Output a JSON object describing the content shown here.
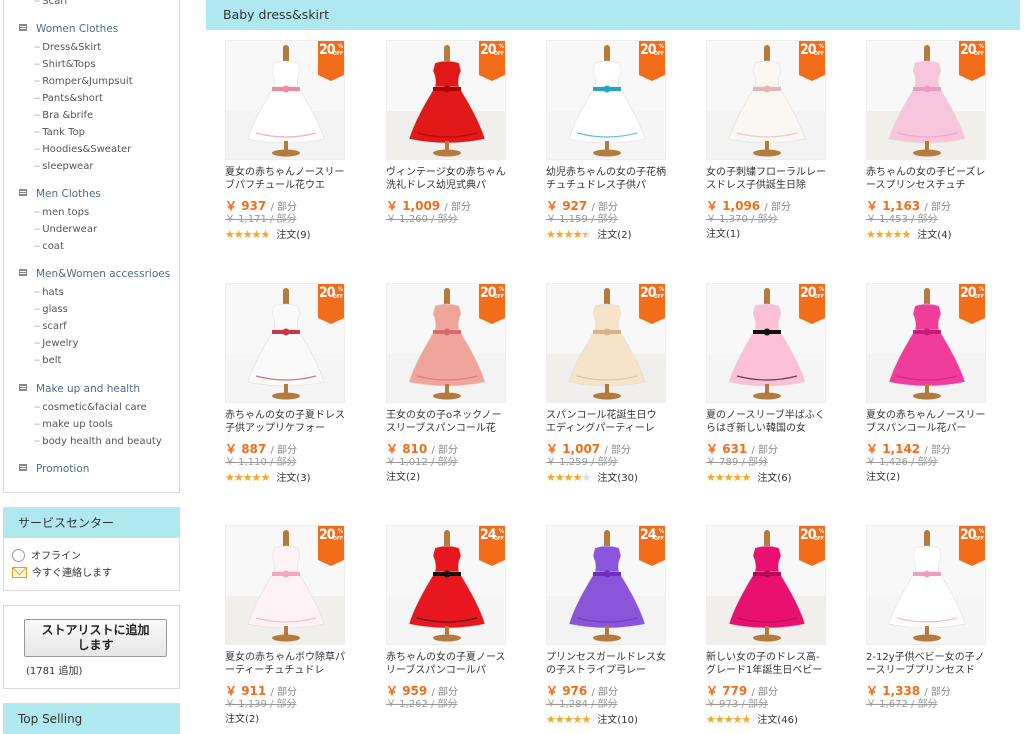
{
  "sidebar": {
    "top_item": "Scarf",
    "groups": [
      {
        "label": "Women Clothes",
        "items": [
          "Dress&Skirt",
          "Shirt&Tops",
          "Romper&Jumpsuit",
          "Pants&short",
          "Bra &brife",
          "Tank Top",
          "Hoodies&Sweater",
          "sleepwear"
        ]
      },
      {
        "label": "Men Clothes",
        "items": [
          "men tops",
          "Underwear",
          "coat"
        ]
      },
      {
        "label": "Men&Women accessrioes",
        "items": [
          "hats",
          "glass",
          "scarf",
          "Jewelry",
          "belt"
        ]
      },
      {
        "label": "Make up and health",
        "items": [
          "cosmetic&facial care",
          "make up tools",
          "body health and beauty"
        ]
      },
      {
        "label": "Promotion",
        "items": []
      }
    ]
  },
  "service": {
    "title": "サービスセンター",
    "offline": "オフライン",
    "contact": "今すぐ連絡します"
  },
  "store": {
    "button_line1": "ストアリストに追加",
    "button_line2": "します",
    "count": "(1781 追加)"
  },
  "top_selling": {
    "title": "Top Selling"
  },
  "main": {
    "heading": "Baby dress&skirt",
    "currency": "￥",
    "unit": "/ 部分",
    "off_label": "OFF",
    "products": [
      {
        "title": "夏女の赤ちゃんノースリーブパフチュール花ウエ",
        "price": "937",
        "old": "￥ 1,171 / 部分",
        "badge": "20",
        "rating": 4.8,
        "orders": "注文(9)",
        "dress_color": "#ffffff",
        "accent": "#f08aa0"
      },
      {
        "title": "ヴィンテージ女の赤ちゃん洗礼ドレス幼児式典パ",
        "price": "1,009",
        "old": "￥ 1,260 / 部分",
        "badge": "20",
        "rating": 0,
        "orders": "",
        "dress_color": "#e01818",
        "accent": "#b00000"
      },
      {
        "title": "幼児赤ちゃんの女の子花柄チュチュドレス子供パ",
        "price": "927",
        "old": "￥ 1,159 / 部分",
        "badge": "20",
        "rating": 4.5,
        "orders": "注文(2)",
        "dress_color": "#ffffff",
        "accent": "#1fa6c9"
      },
      {
        "title": "女の子刺繍フローラルレースドレス子供誕生日除",
        "price": "1,096",
        "old": "￥ 1,370 / 部分",
        "badge": "20",
        "rating": 0,
        "orders": "注文(1)",
        "dress_color": "#fbf7f3",
        "accent": "#e8b4b8"
      },
      {
        "title": "赤ちゃんの女の子ビーズレースプリンセスチュチ",
        "price": "1,163",
        "old": "￥ 1,453 / 部分",
        "badge": "20",
        "rating": 5,
        "orders": "注文(4)",
        "dress_color": "#f7c6dd",
        "accent": "#e99bc2"
      },
      {
        "title": "赤ちゃんの女の子夏ドレス子供アップリケフォー",
        "price": "887",
        "old": "￥ 1,110 / 部分",
        "badge": "20",
        "rating": 5,
        "orders": "注文(3)",
        "dress_color": "#fafafa",
        "accent": "#c43a4a"
      },
      {
        "title": "王女の女の子oネックノースリーブスパンコール花",
        "price": "810",
        "old": "￥ 1,012 / 部分",
        "badge": "20",
        "rating": 0,
        "orders": "注文(2)",
        "dress_color": "#f0a59b",
        "accent": "#d86a70"
      },
      {
        "title": "スパンコール花誕生日ウエディングパーティーレ",
        "price": "1,007",
        "old": "￥ 1,259 / 部分",
        "badge": "20",
        "rating": 4,
        "orders": "注文(30)",
        "dress_color": "#f6e4c8",
        "accent": "#d9b28a"
      },
      {
        "title": "夏のノースリーブ半ばふくらはぎ新しい韓国の女",
        "price": "631",
        "old": "￥ 789 / 部分",
        "badge": "20",
        "rating": 5,
        "orders": "注文(6)",
        "dress_color": "#fbc0d6",
        "accent": "#111111"
      },
      {
        "title": "夏女の赤ちゃんノースリーブスパンコール花パー",
        "price": "1,142",
        "old": "￥ 1,426 / 部分",
        "badge": "20",
        "rating": 0,
        "orders": "注文(2)",
        "dress_color": "#f03c9a",
        "accent": "#c81c78"
      },
      {
        "title": "夏女の赤ちゃんボウ除草パーティーチュチュドレ",
        "price": "911",
        "old": "￥ 1,139 / 部分",
        "badge": "20",
        "rating": 0,
        "orders": "注文(2)",
        "dress_color": "#fdf2f5",
        "accent": "#f3a7c3"
      },
      {
        "title": "赤ちゃんの女の子夏ノースリーブスパンコールパ",
        "price": "959",
        "old": "￥ 1,262 / 部分",
        "badge": "24",
        "rating": 0,
        "orders": "",
        "dress_color": "#e8161e",
        "accent": "#111111"
      },
      {
        "title": "プリンセスガールドレス女の子ストライプ弓レー",
        "price": "976",
        "old": "￥ 1,284 / 部分",
        "badge": "24",
        "rating": 5,
        "orders": "注文(10)",
        "dress_color": "#8a55d8",
        "accent": "#6a2fc0"
      },
      {
        "title": "新しい女の子のドレス高-グレード1年誕生日ベビー",
        "price": "779",
        "old": "￥ 973 / 部分",
        "badge": "20",
        "rating": 4.8,
        "orders": "注文(46)",
        "dress_color": "#e81070",
        "accent": "#b00a55"
      },
      {
        "title": "2-12y子供ベビー女の子ノースリーブプリンセスド",
        "price": "1,338",
        "old": "￥ 1,672 / 部分",
        "badge": "20",
        "rating": 0,
        "orders": "",
        "dress_color": "#ffffff",
        "accent": "#e9a0c4"
      }
    ]
  }
}
